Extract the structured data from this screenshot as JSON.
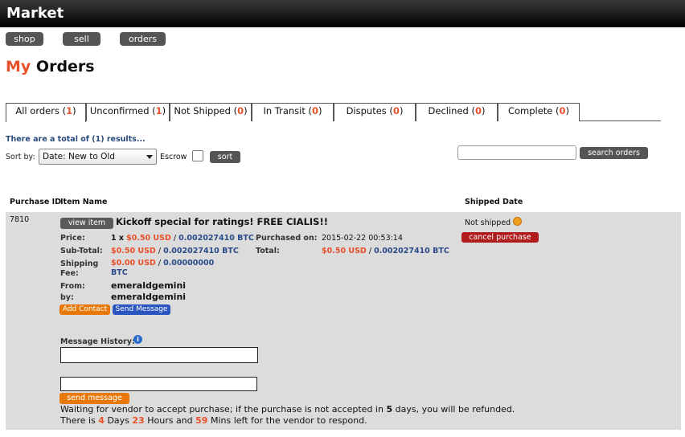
{
  "app": {
    "title": "Market"
  },
  "nav": {
    "shop": "shop",
    "sell": "sell",
    "orders": "orders"
  },
  "heading": {
    "my": "My",
    "rest": "Orders"
  },
  "tabs": [
    {
      "label": "All orders (",
      "count": "1",
      "close": ")"
    },
    {
      "label": "Unconfirmed (",
      "count": "1",
      "close": ")"
    },
    {
      "label": "Not Shipped (",
      "count": "0",
      "close": ")"
    },
    {
      "label": "In Transit (",
      "count": "0",
      "close": ")"
    },
    {
      "label": "Disputes (",
      "count": "0",
      "close": ")"
    },
    {
      "label": "Declined (",
      "count": "0",
      "close": ")"
    },
    {
      "label": "Complete (",
      "count": "0",
      "close": ")"
    }
  ],
  "results": "There are a total of (1) results...",
  "sort": {
    "label": "Sort by:",
    "selected": "Date: New to Old",
    "escrow": "Escrow",
    "button": "sort"
  },
  "search": {
    "value": "",
    "button": "search orders"
  },
  "columns": {
    "purchase_id": "Purchase ID",
    "item_name": "Item Name",
    "shipped_date": "Shipped Date"
  },
  "order": {
    "id": "7810",
    "view_item": "view item",
    "title": "Kickoff special for ratings! FREE CIALIS!!",
    "price_label": "Price:",
    "price_qty": "1 x",
    "price_usd": "$0.50 USD",
    "price_btc": "0.002027410 BTC",
    "purchased_label": "Purchased on:",
    "purchased_value": "2015-02-22 00:53:14",
    "subtotal_label": "Sub-Total:",
    "subtotal_usd": "$0.50 USD",
    "subtotal_btc": "0.002027410 BTC",
    "total_label": "Total:",
    "total_usd": "$0.50 USD",
    "total_btc": "0.002027410 BTC",
    "shipping_label_1": "Shipping",
    "shipping_label_2": "Fee:",
    "shipping_usd": "$0.00 USD",
    "shipping_btc": "0.00000000",
    "shipping_btc_unit": "BTC",
    "from_label": "From:",
    "from_value": "emeraldgemini",
    "by_label": "by:",
    "by_value": "emeraldgemini",
    "add_contact": "Add Contact",
    "send_message": "Send Message",
    "shipped_status": "Not shipped",
    "cancel": "cancel purchase",
    "message_history_label": "Message History:",
    "send_message_button": "send message",
    "status_line1_a": "Waiting for vendor to accept purchase; if the purchase is not accepted in",
    "status_days_accept": "5",
    "status_line1_b": "days, you will be refunded.",
    "status_line2_a": "There is",
    "status_days": "4",
    "status_days_label": "Days",
    "status_hours": "23",
    "status_hours_label": "Hours and",
    "status_mins": "59",
    "status_line2_b": "Mins left for the vendor to respond."
  },
  "colors": {
    "accent": "#e8502a",
    "btc_blue": "#2a4a8a",
    "cancel_red": "#b01c1c",
    "add_contact": "#e8780a",
    "send_msg_blue": "#2a55c0"
  }
}
